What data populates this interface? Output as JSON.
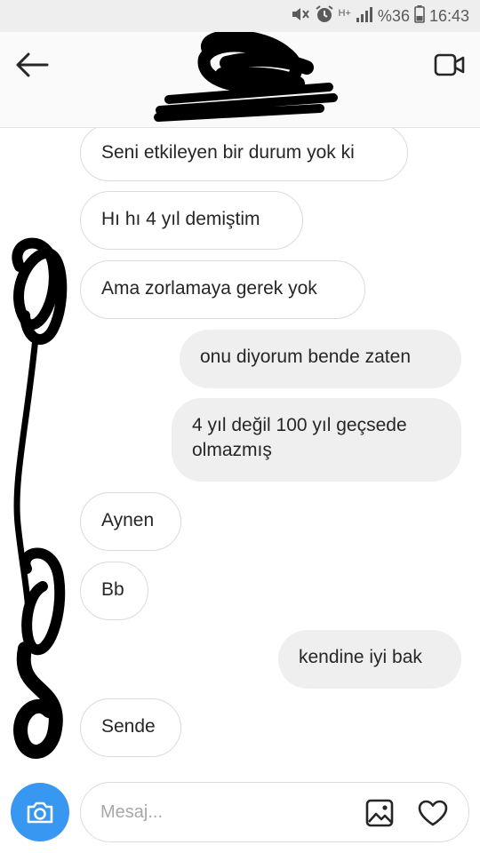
{
  "status_bar": {
    "battery": "%36",
    "time": "16:43",
    "network": "H+"
  },
  "header": {
    "title": "",
    "icons": {
      "back": "arrow-left-icon",
      "video": "video-call-icon"
    }
  },
  "messages": [
    {
      "side": "in",
      "text": "Seni etkileyen bir durum yok ki"
    },
    {
      "side": "in",
      "text": "Hı hı 4 yıl demiştim"
    },
    {
      "side": "in",
      "text": "Ama zorlamaya gerek yok"
    },
    {
      "side": "out",
      "text": "onu diyorum bende zaten"
    },
    {
      "side": "out",
      "text": "4 yıl değil 100 yıl geçsede olmazmış"
    },
    {
      "side": "in",
      "text": "Aynen"
    },
    {
      "side": "in",
      "text": "Bb"
    },
    {
      "side": "out",
      "text": "kendine iyi bak"
    },
    {
      "side": "in",
      "text": "Sende"
    }
  ],
  "composer": {
    "placeholder": "Mesaj...",
    "value": "",
    "icons": {
      "camera": "camera-icon",
      "gallery": "gallery-icon",
      "like": "heart-icon"
    }
  },
  "colors": {
    "accent": "#3897f0",
    "incoming_bubble_border": "#dbdbdb",
    "outgoing_bubble_bg": "#efefef",
    "status_bar_bg": "#eeeeee",
    "header_bg": "#fafafa"
  }
}
